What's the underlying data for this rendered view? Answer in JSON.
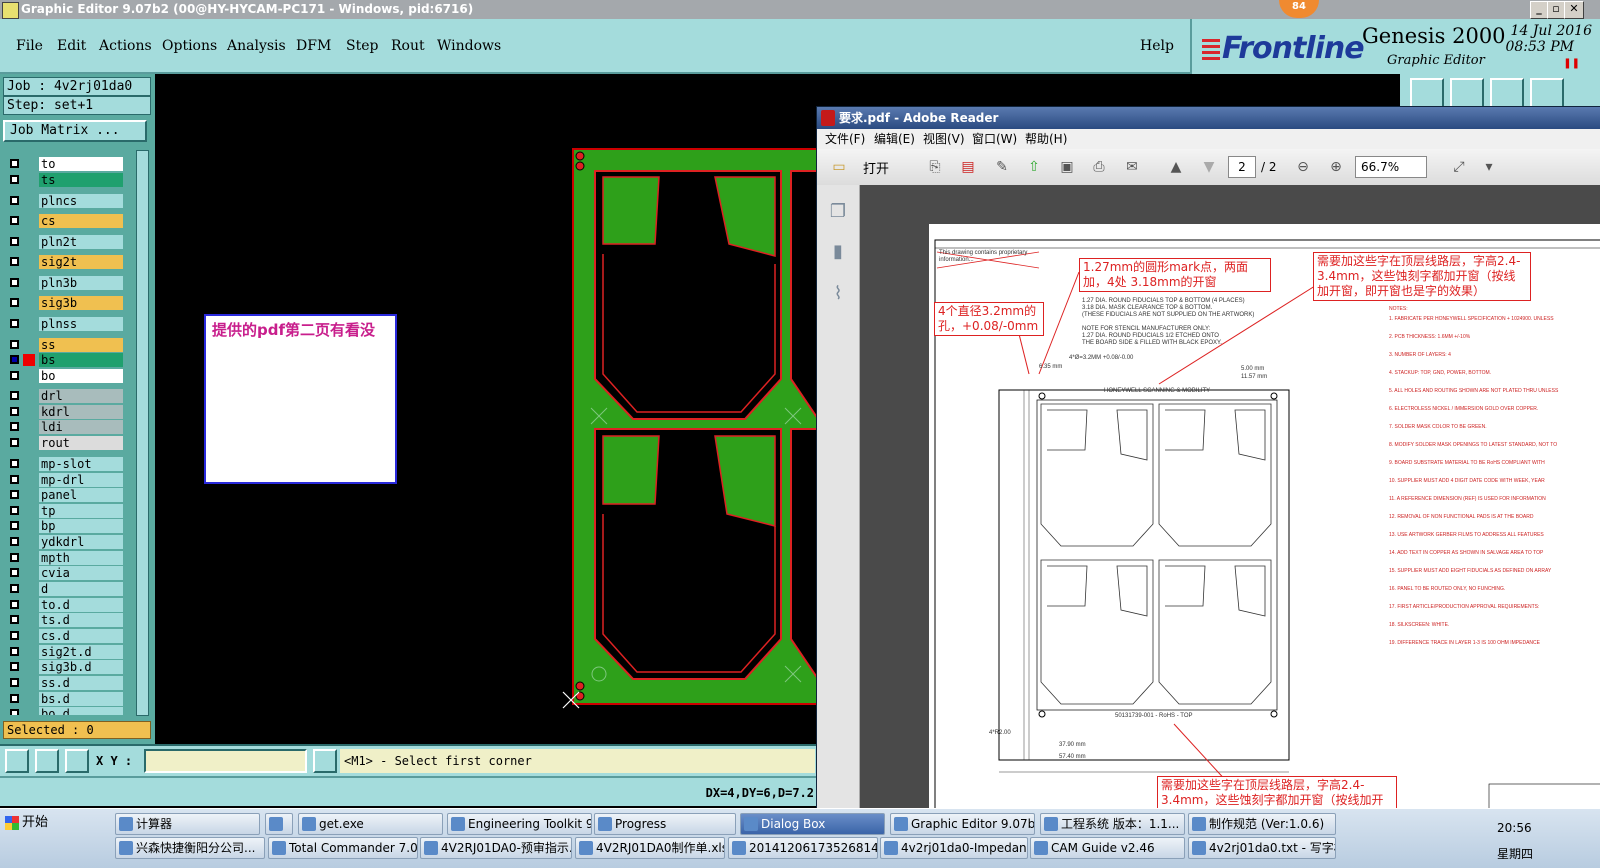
{
  "genesis": {
    "window_title": "Graphic Editor 9.07b2 (00@HY-HYCAM-PC171 - Windows, pid:6716)",
    "badge": "84",
    "menu": [
      "File",
      "Edit",
      "Actions",
      "Options",
      "Analysis",
      "DFM",
      "Step",
      "Rout",
      "Windows"
    ],
    "help": "Help",
    "brand": "Frontline",
    "product": "Genesis 2000",
    "subtitle": "Graphic Editor",
    "date": "14 Jul 2016",
    "time": "08:53 PM",
    "job_label": "Job : 4v2rj01da0",
    "step_label": "Step: set+1",
    "job_matrix": "Job Matrix ...",
    "layers": [
      {
        "name": "to",
        "color": "#ffffff",
        "checked": false
      },
      {
        "name": "ts",
        "color": "#1fa06e",
        "checked": false
      },
      {
        "name": "plncs",
        "color": "#a4dcdc",
        "checked": false
      },
      {
        "name": "cs",
        "color": "#f0c050",
        "checked": false
      },
      {
        "name": "pln2t",
        "color": "#a4dcdc",
        "checked": false
      },
      {
        "name": "sig2t",
        "color": "#f0c050",
        "checked": false
      },
      {
        "name": "pln3b",
        "color": "#a4dcdc",
        "checked": false
      },
      {
        "name": "sig3b",
        "color": "#f0c050",
        "checked": false
      },
      {
        "name": "plnss",
        "color": "#a4dcdc",
        "checked": false
      },
      {
        "name": "ss",
        "color": "#f0c050",
        "checked": false
      },
      {
        "name": "bs",
        "color": "#1fa06e",
        "checked": true
      },
      {
        "name": "bo",
        "color": "#ffffff",
        "checked": false
      },
      {
        "name": "drl",
        "color": "#a8bcbc",
        "checked": false
      },
      {
        "name": "kdrl",
        "color": "#a8bcbc",
        "checked": false
      },
      {
        "name": "ldi",
        "color": "#a8bcbc",
        "checked": false
      },
      {
        "name": "rout",
        "color": "#dcdcdc",
        "checked": false
      },
      {
        "name": "mp-slot",
        "color": "#a4dcdc",
        "checked": false
      },
      {
        "name": "mp-drl",
        "color": "#a4dcdc",
        "checked": false
      },
      {
        "name": "panel",
        "color": "#a4dcdc",
        "checked": false
      },
      {
        "name": "tp",
        "color": "#a4dcdc",
        "checked": false
      },
      {
        "name": "bp",
        "color": "#a4dcdc",
        "checked": false
      },
      {
        "name": "ydkdrl",
        "color": "#a4dcdc",
        "checked": false
      },
      {
        "name": "mpth",
        "color": "#a4dcdc",
        "checked": false
      },
      {
        "name": "cvia",
        "color": "#a4dcdc",
        "checked": false
      },
      {
        "name": "d",
        "color": "#a4dcdc",
        "checked": false
      },
      {
        "name": "to.d",
        "color": "#a4dcdc",
        "checked": false
      },
      {
        "name": "ts.d",
        "color": "#a4dcdc",
        "checked": false
      },
      {
        "name": "cs.d",
        "color": "#a4dcdc",
        "checked": false
      },
      {
        "name": "sig2t.d",
        "color": "#a4dcdc",
        "checked": false
      },
      {
        "name": "sig3b.d",
        "color": "#a4dcdc",
        "checked": false
      },
      {
        "name": "ss.d",
        "color": "#a4dcdc",
        "checked": false
      },
      {
        "name": "bs.d",
        "color": "#a4dcdc",
        "checked": false
      },
      {
        "name": "bo.d",
        "color": "#a4dcdc",
        "checked": false
      }
    ],
    "selected": "Selected : 0",
    "xy_label": "X Y :",
    "xy_value": "",
    "prompt": "<M1> - Select first corner",
    "coords": "DX=4,DY=6,D=7.2",
    "note": "提供的pdf第二页有看没"
  },
  "reader": {
    "title": "要求.pdf - Adobe Reader",
    "menu": [
      "文件(F)",
      "编辑(E)",
      "视图(V)",
      "窗口(W)",
      "帮助(H)"
    ],
    "open": "打开",
    "page_current": "2",
    "page_total": "/ 2",
    "zoom": "66.7%",
    "doc": {
      "note_mark": "1.27mm的圆形mark点，两面加，4处 3.18mm的开窗",
      "note_hole": "4个直径3.2mm的孔，+0.08/-0mm",
      "note_text_top": "需要加这些字在顶层线路层，字高2.4-3.4mm，这些蚀刻字都加开窗（按线加开窗，即开窗也是字的效果）",
      "note_text_bottom": "需要加这些字在顶层线路层，字高2.4-3.4mm，这些蚀刻字都加开窗（按线加开",
      "fid1": "1.27 DIA. ROUND FIDUCIALS TOP & BOTTOM (4 PLACES)",
      "fid2": "3.18 DIA. MASK CLEARANCE TOP & BOTTOM.",
      "fid3": "(THESE FIDUCIALS ARE NOT SUPPLIED ON THE ARTWORK)",
      "stencil1": "NOTE FOR STENCIL MANUFACTURER ONLY:",
      "stencil2": "1.27 DIA. ROUND FIDUCIALS 1/2 ETCHED ONTO",
      "stencil3": "THE BOARD SIDE & FILLED WITH BLACK EPOXY.",
      "hole_dim": "4*Ø=3.2MM +0.08/-0.00",
      "panel_top": "HONEYWELL SCANNING & MOBILITY",
      "panel_bottom": "50131739-001 - RoHS - TOP",
      "notes_title": "NOTES:",
      "notes": [
        "1. FABRICATE PER HONEYWELL SPECIFICATION + 1024900. UNLESS",
        "2. PCB THICKNESS: 1.6MM +/-10%",
        "3. NUMBER OF LAYERS: 4",
        "4. STACKUP: TOP, GND, POWER, BOTTOM.",
        "5. ALL HOLES AND ROUTING SHOWN ARE NOT PLATED THRU UNLESS",
        "6. ELECTROLESS NICKEL / IMMERSION GOLD OVER COPPER.",
        "7. SOLDER MASK COLOR TO BE GREEN.",
        "8. MODIFY SOLDER MASK OPENINGS TO LATEST STANDARD, NOT TO",
        "9. BOARD SUBSTRATE MATERIAL TO BE RoHS COMPLIANT WITH",
        "10. SUPPLIER MUST ADD 4 DIGIT DATE CODE WITH WEEK, YEAR",
        "11. A REFERENCE DIMENSION (REF) IS USED FOR INFORMATION",
        "12. REMOVAL OF NON FUNCTIONAL PADS IS AT THE BOARD",
        "13. USE ARTWORK GERBER FILMS TO ADDRESS ALL FEATURES",
        "14. ADD TEXT IN COPPER AS SHOWN IN SALVAGE AREA TO TOP",
        "15. SUPPLIER MUST ADD EIGHT FIDUCIALS AS DEFINED ON ARRAY",
        "16. PANEL TO BE ROUTED ONLY, NO FUNCHING.",
        "17. FIRST ARTICLE/PRODUCTION APPROVAL REQUIREMENTS:",
        "18. SILKSCREEN: WHITE.",
        "19. DIFFERENCE TRACE IN LAYER 1-3 IS 100 OHM IMPEDANCE"
      ],
      "dims": [
        "6.35 mm",
        "5.00 mm",
        "11.57 mm",
        "4*R2.00",
        "57.40 mm",
        "37.90 mm"
      ]
    }
  },
  "taskbar": {
    "start": "开始",
    "row1": [
      "计算器",
      "",
      "get.exe",
      "Engineering Toolkit 9.0...",
      "Progress",
      "Dialog Box",
      "Graphic Editor 9.07b2 (...",
      "工程系统  版本：1.1...",
      "制作规范 (Ver:1.0.6)"
    ],
    "row2": [
      "兴森快捷衡阳分公司...",
      "Total Commander 7.0 p...",
      "4V2RJ01DA0-预审指示...",
      "4V2RJ01DA0制作单.xls...",
      "20141206173526814.rt...",
      "4v2rj01da0-Impedance...",
      "CAM  Guide v2.46",
      "4v2rj01da0.txt - 写字板"
    ],
    "clock": "20:56",
    "weekday": "星期四"
  }
}
